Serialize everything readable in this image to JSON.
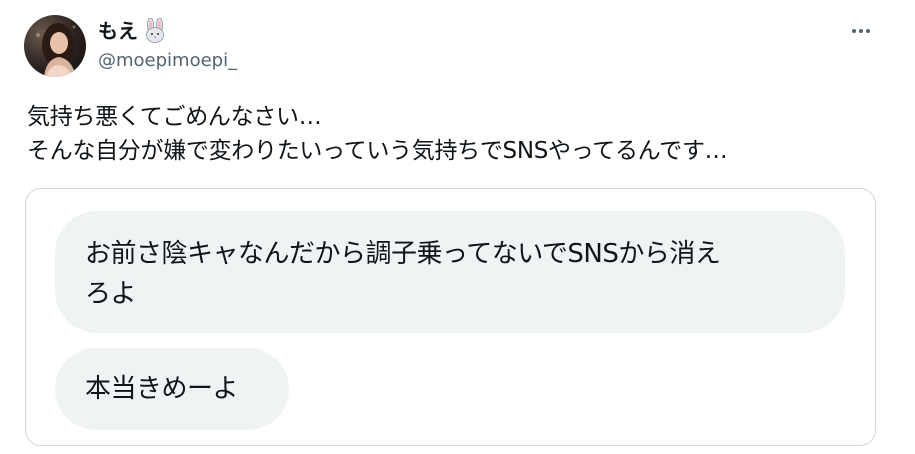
{
  "author": {
    "display_name": "もえ",
    "emoji_icon": "rabbit-face-icon",
    "handle": "@moepimoepi_"
  },
  "tweet": {
    "text_lines": [
      "気持ち悪くてごめんなさい…",
      "そんな自分が嫌で変わりたいっていう気持ちでSNSやってるんです…"
    ]
  },
  "media": {
    "messages": [
      {
        "text_lines": [
          "お前さ陰キャなんだから調子乗ってないでSNSから消え",
          "ろよ"
        ]
      },
      {
        "text_lines": [
          "本当きめーよ"
        ]
      }
    ]
  },
  "colors": {
    "text_primary": "#0f1419",
    "text_secondary": "#536471",
    "bubble_bg": "#eff3f4",
    "card_border": "#cfd9de"
  }
}
